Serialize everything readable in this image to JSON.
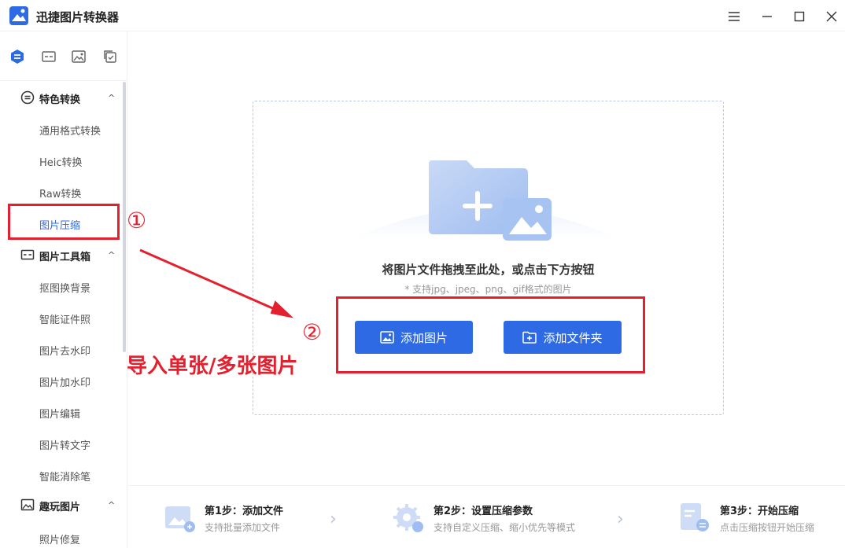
{
  "window": {
    "title": "迅捷图片转换器"
  },
  "sidebar": {
    "groups": [
      {
        "label": "特色转换",
        "items": [
          "通用格式转换",
          "Heic转换",
          "Raw转换",
          "图片压缩"
        ]
      },
      {
        "label": "图片工具箱",
        "items": [
          "抠图换背景",
          "智能证件照",
          "图片去水印",
          "图片加水印",
          "图片编辑",
          "图片转文字",
          "智能消除笔"
        ]
      },
      {
        "label": "趣玩图片",
        "items": [
          "照片修复"
        ]
      }
    ],
    "active_item": "图片压缩"
  },
  "dropzone": {
    "hint": "将图片文件拖拽至此处，或点击下方按钮",
    "supported": "* 支持jpg、jpeg、png、gif格式的图片",
    "add_image_label": "添加图片",
    "add_folder_label": "添加文件夹"
  },
  "steps": [
    {
      "title": "第1步：添加文件",
      "desc": "支持批量添加文件"
    },
    {
      "title": "第2步：设置压缩参数",
      "desc": "支持自定义压缩、缩小优先等模式"
    },
    {
      "title": "第3步：开始压缩",
      "desc": "点击压缩按钮开始压缩"
    }
  ],
  "annotations": {
    "marker_1": "①",
    "marker_2": "②",
    "caption": "导入单张/多张图片"
  },
  "colors": {
    "accent": "#2d6ae3",
    "annotation": "#e5202e"
  }
}
